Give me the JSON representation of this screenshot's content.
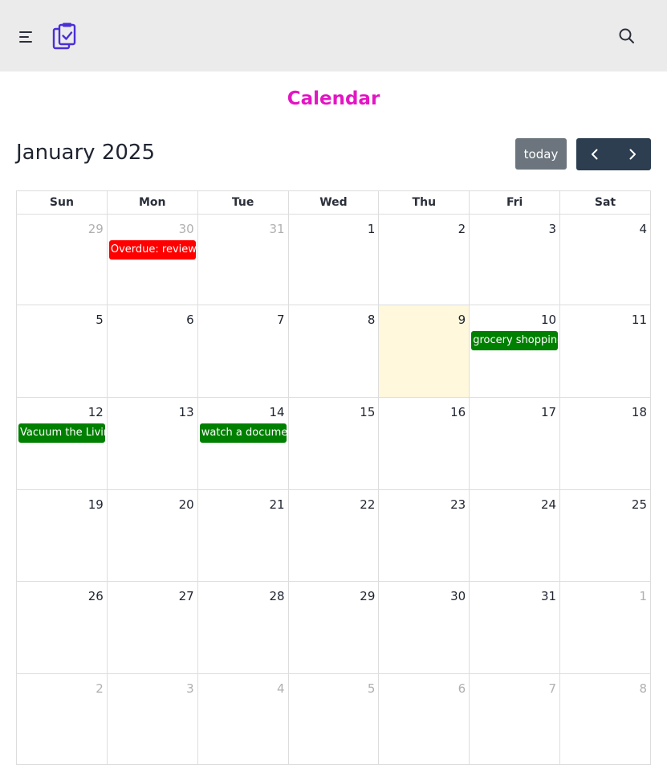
{
  "header": {
    "menu_icon": "hamburger-menu-icon",
    "logo_icon": "clipboard-check-icon",
    "search_icon": "search-icon",
    "logo_color": "#4b2fd6"
  },
  "page": {
    "title": "Calendar",
    "title_color": "#e316c4"
  },
  "toolbar": {
    "month_title": "January 2025",
    "today_label": "today",
    "prev_icon": "chevron-left-icon",
    "next_icon": "chevron-right-icon"
  },
  "calendar": {
    "weekdays": [
      "Sun",
      "Mon",
      "Tue",
      "Wed",
      "Thu",
      "Fri",
      "Sat"
    ],
    "weeks": [
      [
        {
          "day": "29",
          "other": true
        },
        {
          "day": "30",
          "other": true,
          "events": [
            {
              "title": "Overdue: review my notes",
              "color": "#ff0000"
            }
          ]
        },
        {
          "day": "31",
          "other": true
        },
        {
          "day": "1"
        },
        {
          "day": "2"
        },
        {
          "day": "3"
        },
        {
          "day": "4"
        }
      ],
      [
        {
          "day": "5"
        },
        {
          "day": "6"
        },
        {
          "day": "7"
        },
        {
          "day": "8"
        },
        {
          "day": "9",
          "today": true
        },
        {
          "day": "10",
          "events": [
            {
              "title": "grocery shopping",
              "color": "#008000"
            }
          ]
        },
        {
          "day": "11"
        }
      ],
      [
        {
          "day": "12",
          "events": [
            {
              "title": "Vacuum the Living Room",
              "color": "#008000"
            }
          ]
        },
        {
          "day": "13"
        },
        {
          "day": "14",
          "events": [
            {
              "title": "watch a documentary",
              "color": "#008000"
            }
          ]
        },
        {
          "day": "15"
        },
        {
          "day": "16"
        },
        {
          "day": "17"
        },
        {
          "day": "18"
        }
      ],
      [
        {
          "day": "19"
        },
        {
          "day": "20"
        },
        {
          "day": "21"
        },
        {
          "day": "22"
        },
        {
          "day": "23"
        },
        {
          "day": "24"
        },
        {
          "day": "25"
        }
      ],
      [
        {
          "day": "26"
        },
        {
          "day": "27"
        },
        {
          "day": "28"
        },
        {
          "day": "29"
        },
        {
          "day": "30"
        },
        {
          "day": "31"
        },
        {
          "day": "1",
          "other": true
        }
      ],
      [
        {
          "day": "2",
          "other": true
        },
        {
          "day": "3",
          "other": true
        },
        {
          "day": "4",
          "other": true
        },
        {
          "day": "5",
          "other": true
        },
        {
          "day": "6",
          "other": true
        },
        {
          "day": "7",
          "other": true
        },
        {
          "day": "8",
          "other": true
        }
      ]
    ]
  }
}
